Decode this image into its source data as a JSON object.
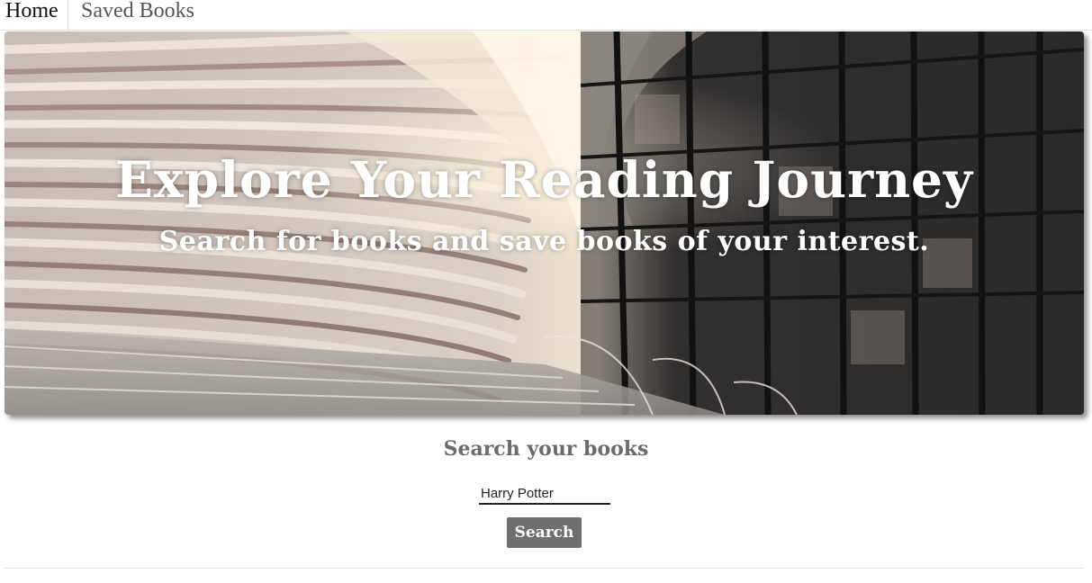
{
  "nav": {
    "home_label": "Home",
    "saved_label": "Saved Books"
  },
  "hero": {
    "title": "Explore Your Reading Journey",
    "subtitle": "Search for books and save books of your interest.",
    "image": "library-bookshelves-photo"
  },
  "search": {
    "heading": "Search your books",
    "input_value": "Harry Potter",
    "button_label": "Search"
  },
  "colors": {
    "button_bg": "#6f6f6f",
    "heading": "#6b6b6b",
    "input_underline": "#222222"
  }
}
